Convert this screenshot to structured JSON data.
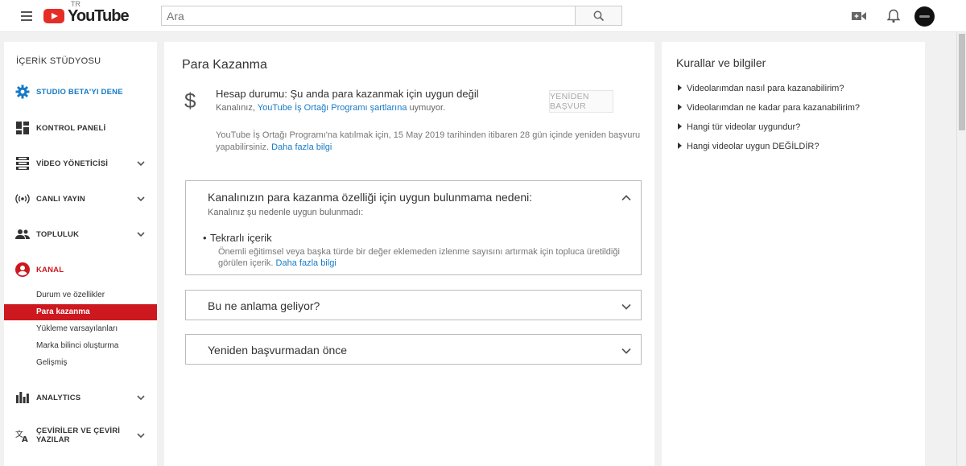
{
  "header": {
    "logo_text": "YouTube",
    "logo_region": "TR",
    "search_placeholder": "Ara"
  },
  "sidebar": {
    "title": "İÇERİK STÜDYOSU",
    "beta": "STUDIO BETA'YI DENE",
    "items": [
      {
        "label": "KONTROL PANELİ"
      },
      {
        "label": "VİDEO YÖNETİCİSİ"
      },
      {
        "label": "CANLI YAYIN"
      },
      {
        "label": "TOPLULUK"
      },
      {
        "label": "KANAL"
      },
      {
        "label": "ANALYTICS"
      },
      {
        "label": "ÇEVİRİLER VE ÇEVİRİ YAZILAR"
      }
    ],
    "channel_sub": [
      {
        "label": "Durum ve özellikler"
      },
      {
        "label": "Para kazanma"
      },
      {
        "label": "Yükleme varsayılanları"
      },
      {
        "label": "Marka bilinci oluşturma"
      },
      {
        "label": "Gelişmiş"
      }
    ]
  },
  "main": {
    "title": "Para Kazanma",
    "status_title": "Hesap durumu: Şu anda para kazanmak için uygun değil",
    "status_sub_pre": "Kanalınız, ",
    "status_sub_link": "YouTube İş Ortağı Programı şartlarına",
    "status_sub_post": " uymuyor.",
    "reapply_button": "YENİDEN BAŞVUR",
    "note_text": "YouTube İş Ortağı Programı'na katılmak için, 15 May 2019 tarihinden itibaren 28 gün içinde yeniden başvuru yapabilirsiniz. ",
    "note_link": "Daha fazla bilgi",
    "reason_box": {
      "title": "Kanalınızın para kazanma özelliği için uygun bulunmama nedeni:",
      "subtitle": "Kanalınız şu nedenle uygun bulunmadı:",
      "reason": "Tekrarlı içerik",
      "reason_desc": "Önemli eğitimsel veya başka türde bir değer eklemeden izlenme sayısını artırmak için topluca üretildiği görülen içerik.  ",
      "reason_link": "Daha fazla bilgi"
    },
    "meaning_box": {
      "title": "Bu ne anlama geliyor?"
    },
    "before_box": {
      "title": "Yeniden başvurmadan önce"
    }
  },
  "right": {
    "title": "Kurallar ve bilgiler",
    "faq": [
      "Videolarımdan nasıl para kazanabilirim?",
      "Videolarımdan ne kadar para kazanabilirim?",
      "Hangi tür videolar uygundur?",
      "Hangi videolar uygun DEĞİLDİR?"
    ]
  },
  "colors": {
    "accent_red": "#cc181e",
    "link_blue": "#167ac6",
    "beta_blue": "#167ac6"
  }
}
